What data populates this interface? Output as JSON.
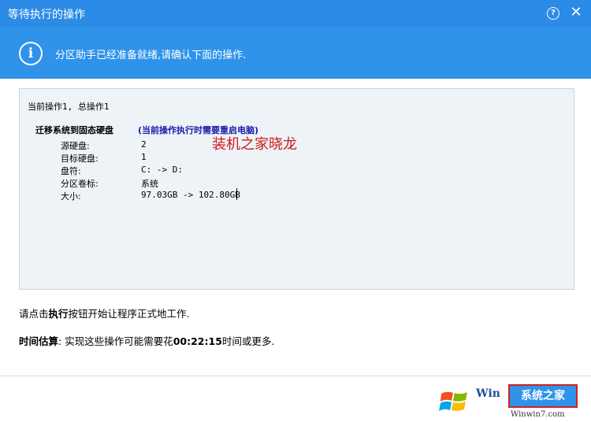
{
  "window": {
    "title": "等待执行的操作",
    "help_label": "?",
    "close_label": "✕"
  },
  "banner": {
    "icon": "info-icon",
    "icon_glyph": "i",
    "message": "分区助手已经准备就绪,请确认下面的操作."
  },
  "operations": {
    "count_line": "当前操作1, 总操作1",
    "title": "迁移系统到固态硬盘",
    "note": "(当前操作执行时需要重启电脑)",
    "details": [
      {
        "label": "源硬盘:",
        "value": "2"
      },
      {
        "label": "目标硬盘:",
        "value": "1"
      },
      {
        "label": "盘符:",
        "value": "C: -> D:"
      },
      {
        "label": "分区卷标:",
        "value": "系统"
      },
      {
        "label": "大小:",
        "value": "97.03GB -> 102.80GB"
      }
    ]
  },
  "watermark": "装机之家晓龙",
  "hint": {
    "prefix": "请点击",
    "bold": "执行",
    "suffix": "按钮开始让程序正式地工作."
  },
  "estimate": {
    "label": "时间估算",
    "prefix": ": 实现这些操作可能需要花",
    "time": "00:22:15",
    "suffix": "时间或更多."
  },
  "footer": {
    "execute_label": "系统之家",
    "logo_text": "Win",
    "logo_url": "Winwin7.com"
  },
  "colors": {
    "titlebar": "#2b8be6",
    "banner": "#2f93ea",
    "note_text": "#1a1aa8",
    "watermark": "#d11818"
  }
}
